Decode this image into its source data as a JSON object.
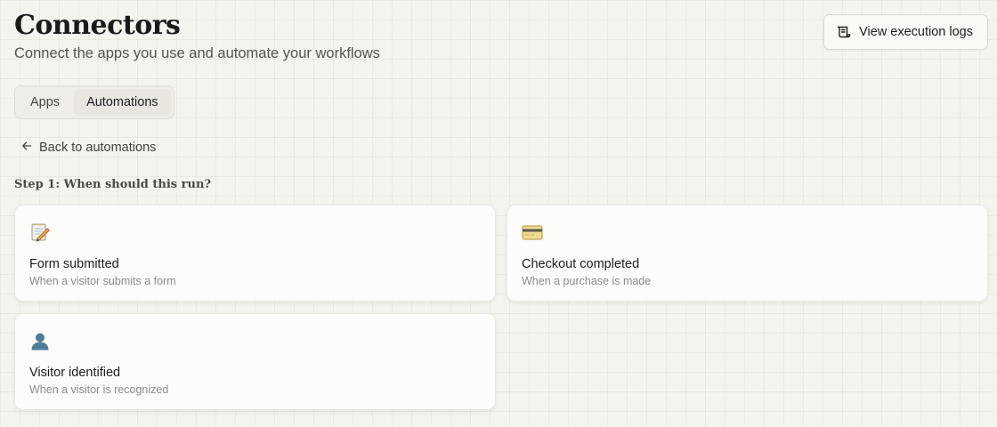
{
  "header": {
    "title": "Connectors",
    "subtitle": "Connect the apps you use and automate your workflows"
  },
  "logs_button": {
    "label": "View execution logs",
    "icon": "scroll-icon"
  },
  "tabs": [
    {
      "label": "Apps",
      "active": false
    },
    {
      "label": "Automations",
      "active": true
    }
  ],
  "back_link": {
    "label": "Back to automations",
    "icon": "arrow-left-icon"
  },
  "step_label": "Step 1: When should this run?",
  "triggers": [
    {
      "title": "Form submitted",
      "description": "When a visitor submits a form",
      "icon": "memo-icon"
    },
    {
      "title": "Checkout completed",
      "description": "When a purchase is made",
      "icon": "credit-card-icon"
    },
    {
      "title": "Visitor identified",
      "description": "When a visitor is recognized",
      "icon": "person-silhouette-icon"
    }
  ]
}
